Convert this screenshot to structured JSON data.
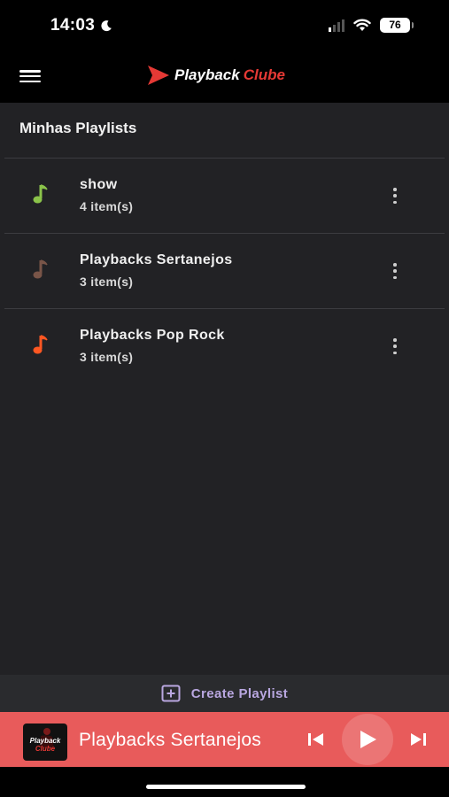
{
  "status_bar": {
    "time": "14:03",
    "battery": "76"
  },
  "header": {
    "brand_part1": "Playback",
    "brand_part2": "Clube"
  },
  "section": {
    "title": "Minhas Playlists"
  },
  "playlists": [
    {
      "name": "show",
      "count": "4 item(s)",
      "icon_color": "#8bc34a"
    },
    {
      "name": "Playbacks Sertanejos",
      "count": "3 item(s)",
      "icon_color": "#795548"
    },
    {
      "name": "Playbacks Pop Rock",
      "count": "3 item(s)",
      "icon_color": "#ff5722"
    }
  ],
  "create_playlist": {
    "label": "Create Playlist"
  },
  "mini_player": {
    "title": "Playbacks Sertanejos",
    "thumb_text1": "Playback",
    "thumb_text2": "Clube"
  },
  "colors": {
    "background": "#222225",
    "accent": "#e53935",
    "player_bg": "#e85b5b",
    "create_label": "#b9a7e0"
  },
  "icons": {
    "menu": "hamburger-icon",
    "playlist": "music-note-icon",
    "more": "more-vertical-icon",
    "create": "add-box-icon",
    "prev": "skip-previous-icon",
    "play": "play-icon",
    "next": "skip-next-icon"
  }
}
